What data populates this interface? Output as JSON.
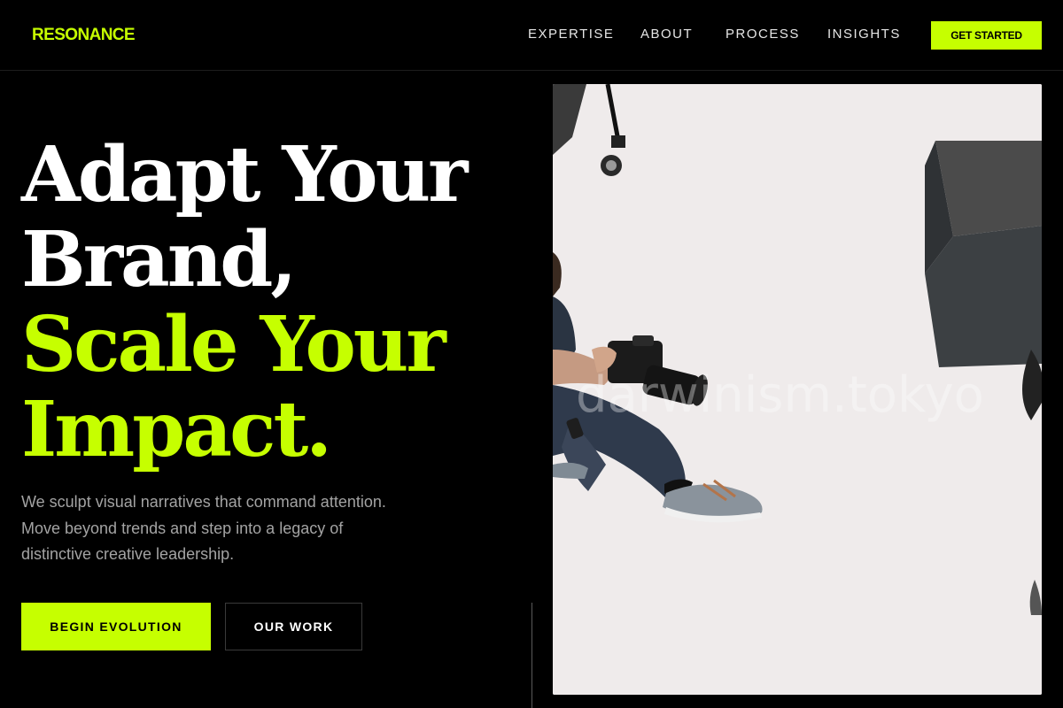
{
  "header": {
    "logo": "RESONANCE",
    "nav": [
      "EXPERTISE",
      "ABOUT",
      "PROCESS",
      "INSIGHTS"
    ],
    "cta_label": "GET STARTED"
  },
  "hero": {
    "headline_white": [
      "Adapt Your",
      "Brand,"
    ],
    "headline_accent": [
      "Scale Your",
      "Impact."
    ],
    "subtext_lines": [
      "We sculpt visual narratives that command attention.",
      "Move beyond trends and step into a legacy of",
      "distinctive creative leadership."
    ],
    "primary_button": "BEGIN EVOLUTION",
    "secondary_button": "OUR WORK"
  },
  "photo": {
    "watermark": "darwinism.tokyo",
    "subject_icon": "photographer-with-camera-photo"
  },
  "colors": {
    "background": "#000000",
    "accent": "#c6ff00",
    "text_primary": "#ffffff",
    "text_muted": "#a3a3a3"
  }
}
